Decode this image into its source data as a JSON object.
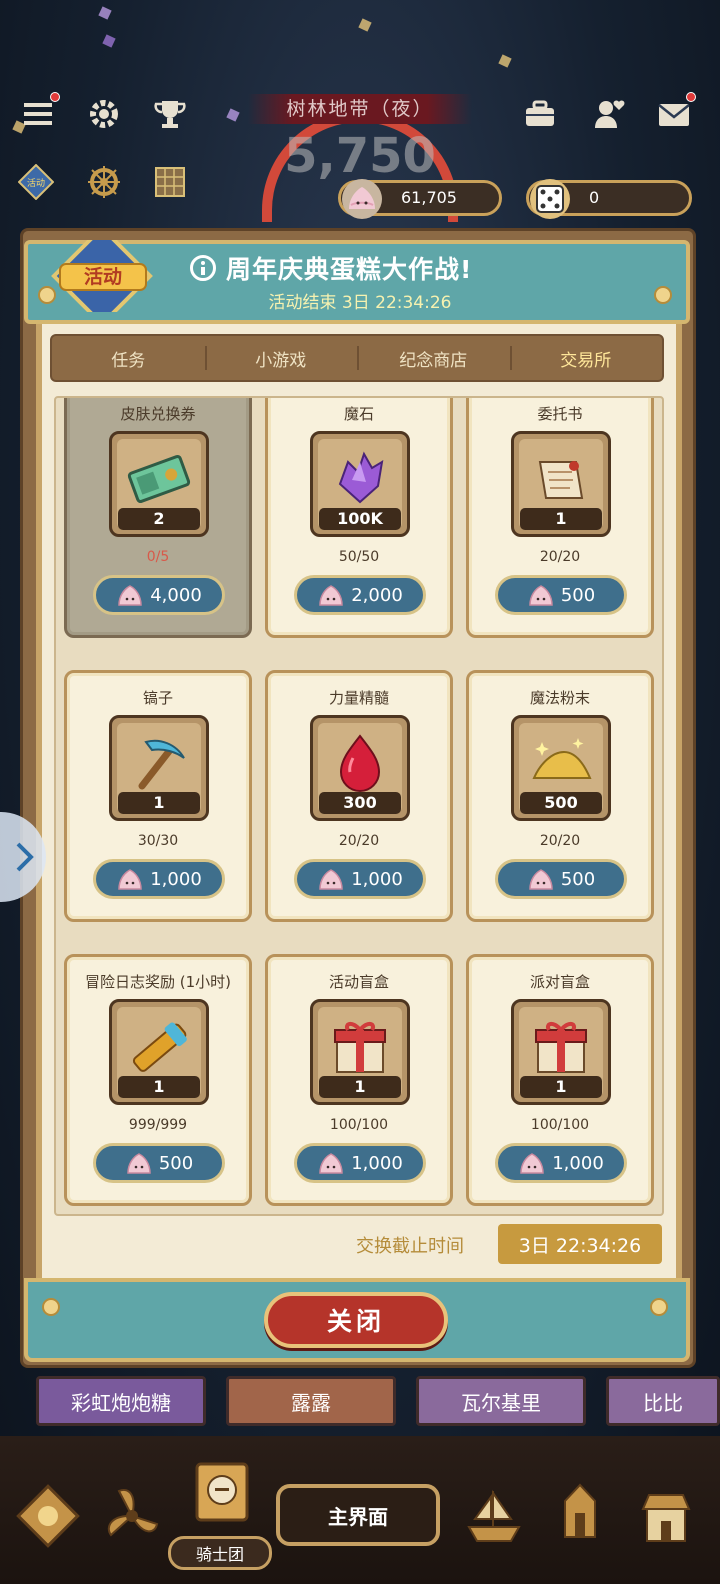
{
  "hud": {
    "region": "树林地带（夜）",
    "score": "5,750",
    "cake_currency": "61,705",
    "dice_currency": "0"
  },
  "left_icons": {
    "event_label": "活动"
  },
  "modal": {
    "badge": "活动",
    "title": "周年庆典蛋糕大作战!",
    "timer": "活动结束 3日 22:34:26",
    "tabs": [
      {
        "label": "任务"
      },
      {
        "label": "小游戏"
      },
      {
        "label": "纪念商店"
      },
      {
        "label": "交易所"
      }
    ],
    "items": [
      {
        "name": "皮肤兑换券",
        "qty": "2",
        "stock": "0/5",
        "price": "4,000",
        "icon": "ticket-icon"
      },
      {
        "name": "魔石",
        "qty": "100K",
        "stock": "50/50",
        "price": "2,000",
        "icon": "crystal-icon"
      },
      {
        "name": "委托书",
        "qty": "1",
        "stock": "20/20",
        "price": "500",
        "icon": "scroll-icon"
      },
      {
        "name": "镐子",
        "qty": "1",
        "stock": "30/30",
        "price": "1,000",
        "icon": "pickaxe-icon"
      },
      {
        "name": "力量精髓",
        "qty": "300",
        "stock": "20/20",
        "price": "1,000",
        "icon": "ruby-icon"
      },
      {
        "name": "魔法粉末",
        "qty": "500",
        "stock": "20/20",
        "price": "500",
        "icon": "powder-icon"
      },
      {
        "name": "冒险日志奖励 (1小时)",
        "qty": "1",
        "stock": "999/999",
        "price": "500",
        "icon": "telescope-icon"
      },
      {
        "name": "活动盲盒",
        "qty": "1",
        "stock": "100/100",
        "price": "1,000",
        "icon": "giftbox-icon"
      },
      {
        "name": "派对盲盒",
        "qty": "1",
        "stock": "100/100",
        "price": "1,000",
        "icon": "giftbox-icon"
      }
    ],
    "deadline_label": "交换截止时间",
    "deadline_value": "3日 22:34:26",
    "close_label": "关闭"
  },
  "behind_buttons": [
    "彩虹炮炮糖",
    "露露",
    "瓦尔基里",
    "比比"
  ],
  "bottom_nav": {
    "main_label": "主界面",
    "knight_label": "骑士团"
  },
  "colors": {
    "teal": "#5fa6a8",
    "gold_border": "#d4b66f",
    "price_blue": "#3f6f8c",
    "close_red": "#b5342a"
  }
}
